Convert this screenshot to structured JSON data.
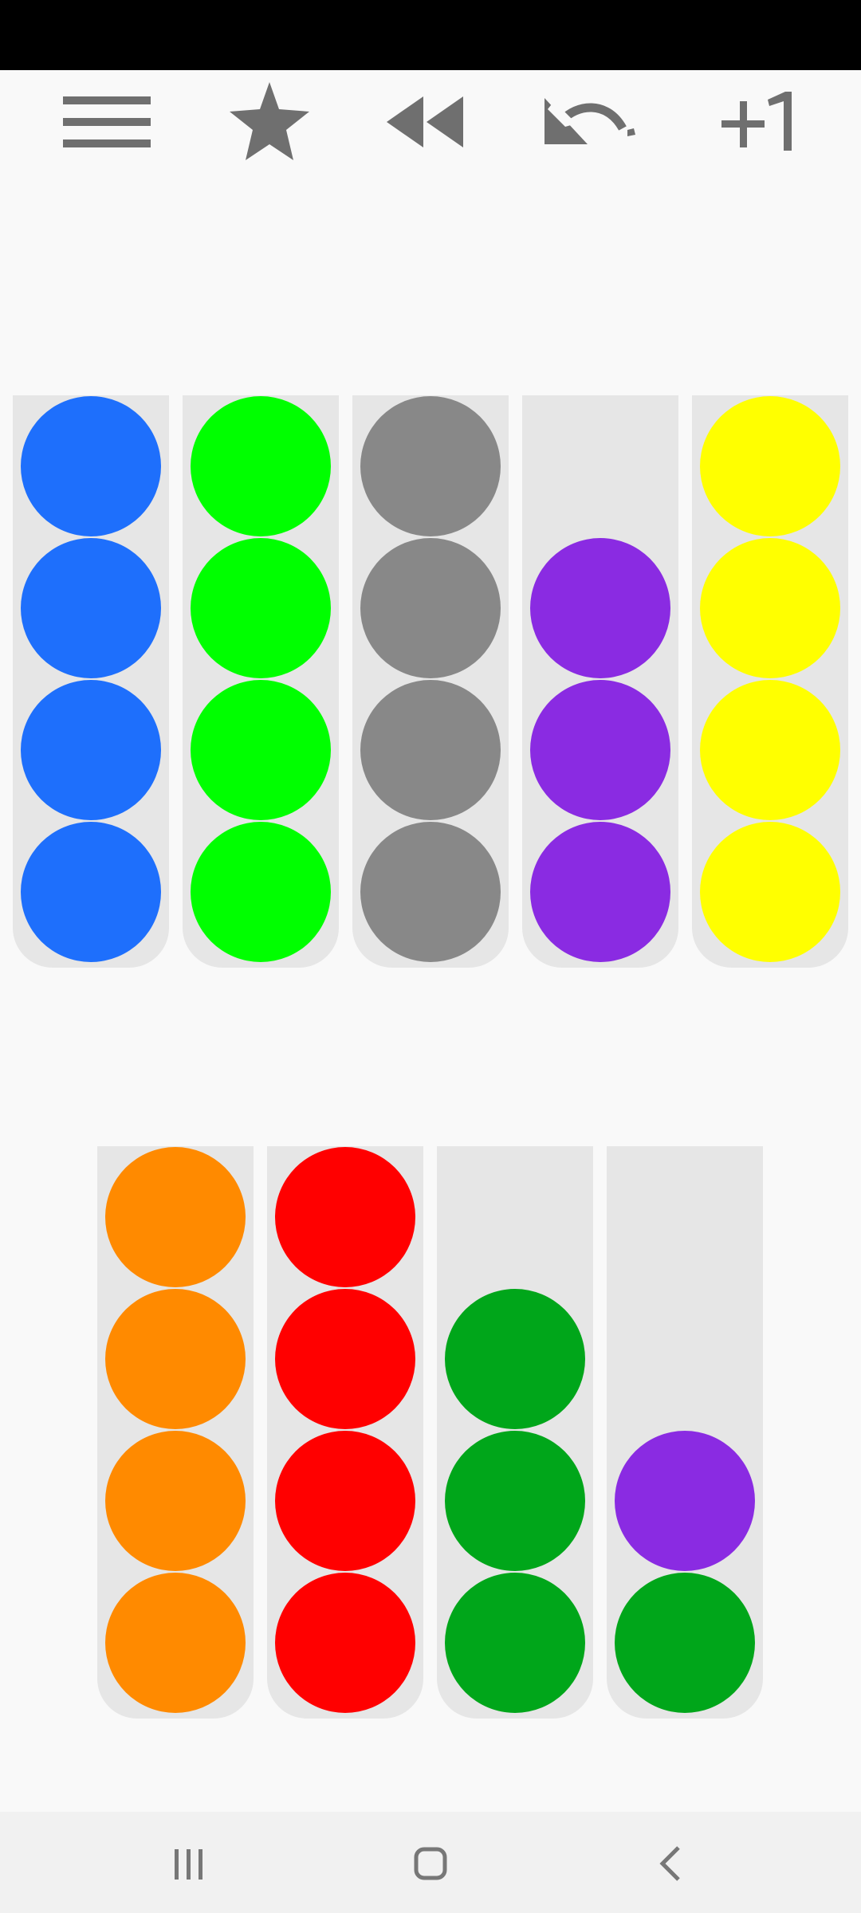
{
  "colors": {
    "background": "#f9f9f9",
    "toolbar_icon": "#6f6f6f",
    "tube": "#e6e6e6",
    "nav_icon": "#777777",
    "balls": {
      "blue": "#1e6ffc",
      "lime": "#00ff00",
      "gray": "#888888",
      "purple": "#8a2be2",
      "yellow": "#ffff00",
      "orange": "#ff8a00",
      "red": "#ff0000",
      "green": "#00a61a"
    }
  },
  "toolbar": {
    "menu_icon": "hamburger-menu-icon",
    "star_icon": "star-icon",
    "rewind_icon": "rewind-icon",
    "undo_icon": "undo-icon",
    "plus_one_label": "+1"
  },
  "capacity": 4,
  "tubes": [
    {
      "row": 1,
      "balls": [
        "blue",
        "blue",
        "blue",
        "blue"
      ]
    },
    {
      "row": 1,
      "balls": [
        "lime",
        "lime",
        "lime",
        "lime"
      ]
    },
    {
      "row": 1,
      "balls": [
        "gray",
        "gray",
        "gray",
        "gray"
      ]
    },
    {
      "row": 1,
      "balls": [
        "purple",
        "purple",
        "purple"
      ]
    },
    {
      "row": 1,
      "balls": [
        "yellow",
        "yellow",
        "yellow",
        "yellow"
      ]
    },
    {
      "row": 2,
      "balls": [
        "orange",
        "orange",
        "orange",
        "orange"
      ]
    },
    {
      "row": 2,
      "balls": [
        "red",
        "red",
        "red",
        "red"
      ]
    },
    {
      "row": 2,
      "balls": [
        "green",
        "green",
        "green"
      ]
    },
    {
      "row": 2,
      "balls": [
        "green",
        "purple"
      ]
    }
  ],
  "nav": {
    "recents_icon": "recents-icon",
    "home_icon": "home-icon",
    "back_icon": "back-icon"
  }
}
